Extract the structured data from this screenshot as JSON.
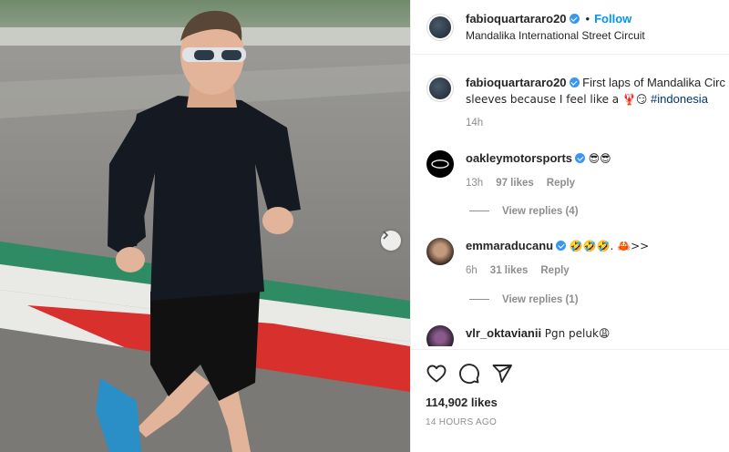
{
  "post": {
    "author": "fabioquartararo20",
    "follow_label": "Follow",
    "location": "Mandalika International Street Circuit",
    "separator": "•"
  },
  "caption": {
    "author": "fabioquartararo20",
    "text_line1": "First laps of Mandalika Circ",
    "text_line2": "sleeves because I feel like a 🦞😏",
    "hashtag": "#indonesia",
    "time": "14h"
  },
  "comments": [
    {
      "author": "oakleymotorsports",
      "text": "😎😎",
      "time": "13h",
      "likes": "97 likes",
      "reply_label": "Reply",
      "view_replies": "View replies (4)"
    },
    {
      "author": "emmaraducanu",
      "text": "🤣🤣🤣. 🦀>>",
      "time": "6h",
      "likes": "31 likes",
      "reply_label": "Reply",
      "view_replies": "View replies (1)"
    },
    {
      "author": "vlr_oktavianii",
      "text": "Pgn peluk😩"
    }
  ],
  "actions": {
    "icons": [
      "heart-icon",
      "comment-icon",
      "share-icon"
    ],
    "likes_count": "114,902 likes",
    "posted_ago": "14 HOURS AGO"
  },
  "colors": {
    "accent": "#0095f6",
    "verified": "#3897f0",
    "hashtag": "#00376b",
    "muted": "#8e8e8e"
  }
}
